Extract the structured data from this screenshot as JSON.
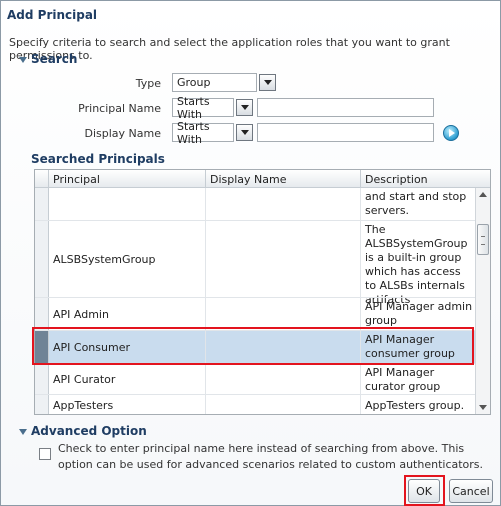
{
  "dialog": {
    "title": "Add Principal",
    "instructions": "Specify criteria to search and select the application roles that you want to grant permissions to."
  },
  "search": {
    "header": "Search",
    "type_label": "Type",
    "type_value": "Group",
    "principal_name_label": "Principal Name",
    "principal_name_operator": "Starts With",
    "principal_name_value": "",
    "display_name_label": "Display Name",
    "display_name_operator": "Starts With",
    "display_name_value": ""
  },
  "results": {
    "header": "Searched Principals",
    "columns": [
      "Principal",
      "Display Name",
      "Description"
    ],
    "rows": [
      {
        "principal": "",
        "display_name": "",
        "description": "and start and stop servers."
      },
      {
        "principal": "ALSBSystemGroup",
        "display_name": "",
        "description": "The ALSBSystemGroup is a built-in group which has access to ALSBs internals artifacts"
      },
      {
        "principal": "API Admin",
        "display_name": "",
        "description": "API Manager admin group"
      },
      {
        "principal": "API Consumer",
        "display_name": "",
        "description": "API Manager consumer group"
      },
      {
        "principal": "API Curator",
        "display_name": "",
        "description": "API Manager curator group"
      },
      {
        "principal": "AppTesters",
        "display_name": "",
        "description": "AppTesters group."
      }
    ]
  },
  "advanced": {
    "header": "Advanced Option",
    "checkbox_label": "Check to enter principal name here instead of searching from above. This option can be used for advanced scenarios related to custom authenticators."
  },
  "buttons": {
    "ok": "OK",
    "cancel": "Cancel"
  },
  "colors": {
    "header_text": "#1f3d63",
    "selected_row": "#c9dcee",
    "highlight": "#e3141e"
  },
  "icons": {
    "search_section_toggle": "triangle-down-icon",
    "advanced_section_toggle": "triangle-down-icon",
    "go": "go-arrow-icon",
    "dropdown": "chevron-down-icon"
  }
}
